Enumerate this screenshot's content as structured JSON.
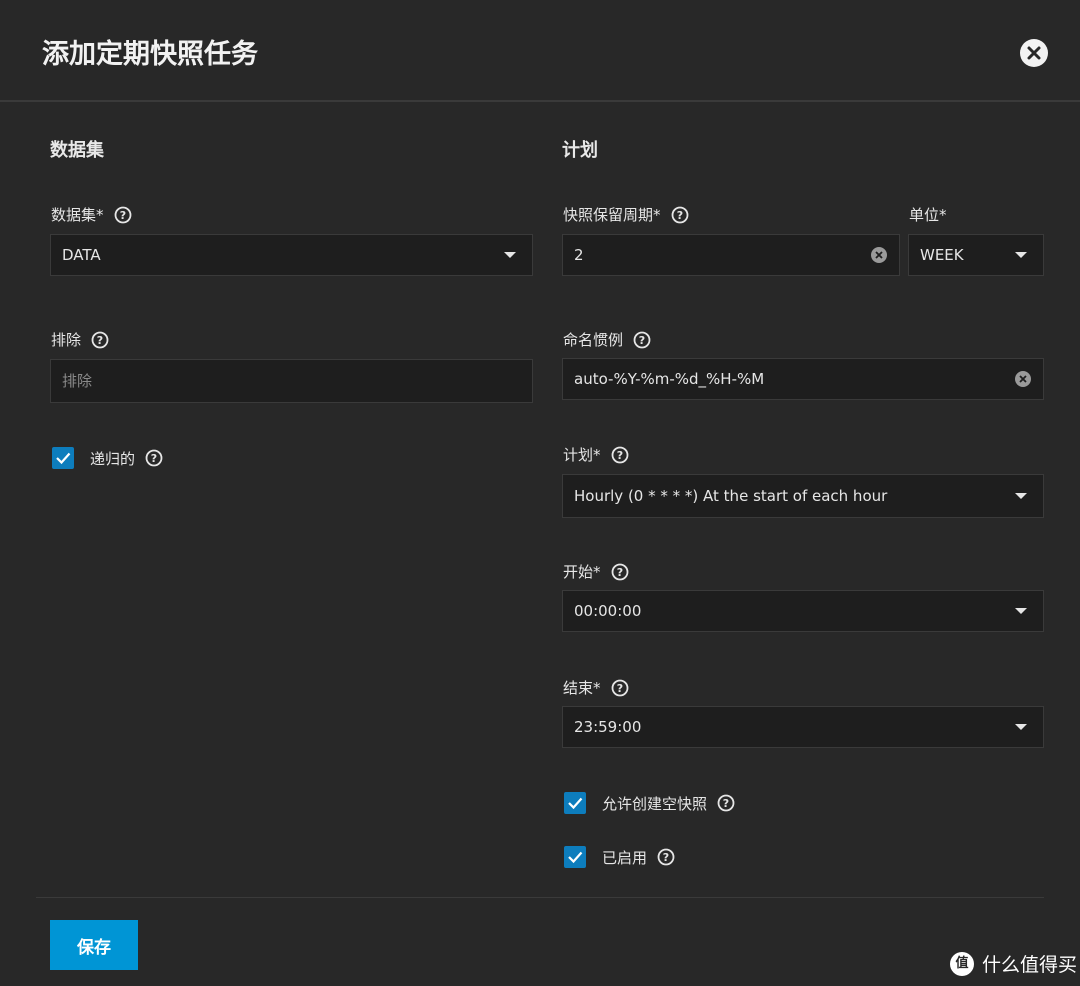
{
  "dialog": {
    "title": "添加定期快照任务",
    "close_icon": "close-circle-icon"
  },
  "left": {
    "section_title": "数据集",
    "dataset": {
      "label": "数据集*",
      "value": "DATA"
    },
    "exclude": {
      "label": "排除",
      "placeholder": "排除"
    },
    "recursive": {
      "label": "递归的",
      "checked": true
    }
  },
  "right": {
    "section_title": "计划",
    "lifetime": {
      "label": "快照保留周期*",
      "value": "2"
    },
    "unit": {
      "label": "单位*",
      "value": "WEEK"
    },
    "naming": {
      "label": "命名惯例",
      "value": "auto-%Y-%m-%d_%H-%M"
    },
    "schedule": {
      "label": "计划*",
      "value": "Hourly (0 * * * *)  At the start of each hour"
    },
    "begin": {
      "label": "开始*",
      "value": "00:00:00"
    },
    "end": {
      "label": "结束*",
      "value": "23:59:00"
    },
    "allow_empty": {
      "label": "允许创建空快照",
      "checked": true
    },
    "enabled": {
      "label": "已启用",
      "checked": true
    }
  },
  "footer": {
    "save_label": "保存"
  },
  "watermark": {
    "logo_text": "值",
    "text": "什么值得买"
  },
  "colors": {
    "accent": "#0095d5",
    "checkbox": "#0d7dbd",
    "background": "#282828",
    "field": "#1e1e1e"
  }
}
